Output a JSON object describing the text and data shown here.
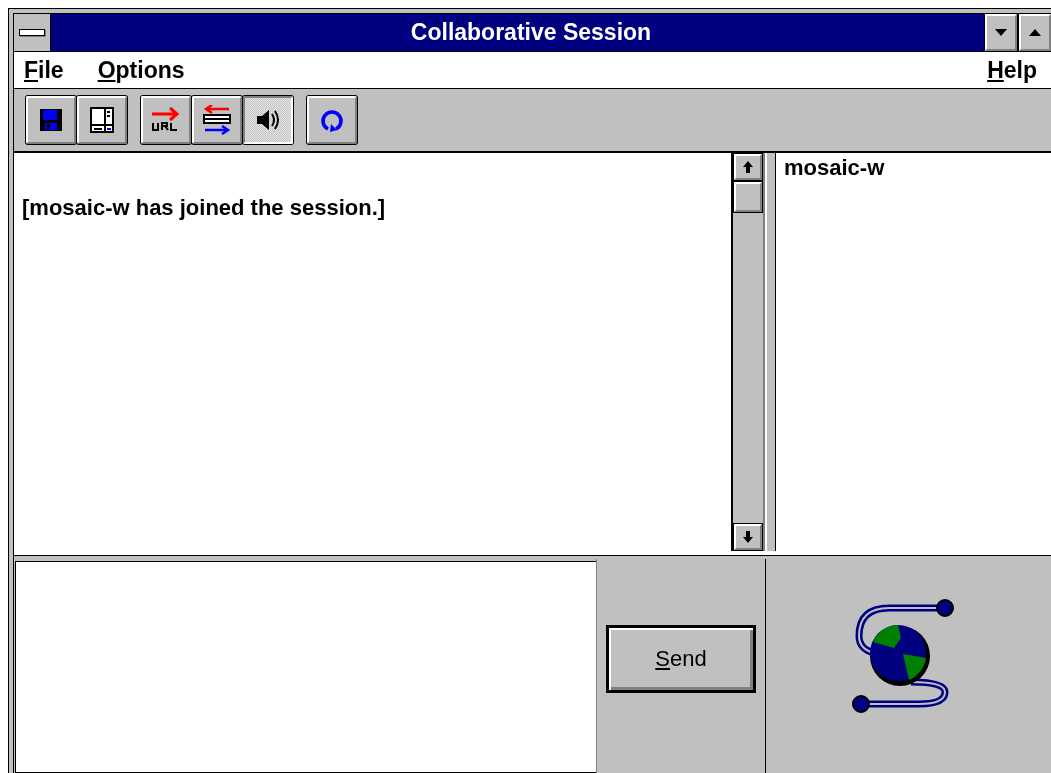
{
  "window": {
    "title": "Collaborative Session"
  },
  "menu": [
    {
      "label": "File"
    },
    {
      "label": "Options"
    },
    {
      "label": "Help"
    }
  ],
  "toolbar": [
    [
      {
        "kind": "save",
        "pressed": false
      },
      {
        "kind": "panel",
        "pressed": false
      }
    ],
    [
      {
        "kind": "url",
        "pressed": false
      },
      {
        "kind": "sync",
        "pressed": false
      },
      {
        "kind": "sound",
        "pressed": true
      }
    ],
    [
      {
        "kind": "refresh",
        "pressed": false
      }
    ]
  ],
  "chat": {
    "messages": [
      "[mosaic-w has joined the session.]"
    ]
  },
  "participants": [
    "mosaic-w"
  ],
  "send_button": {
    "label": "Send"
  }
}
